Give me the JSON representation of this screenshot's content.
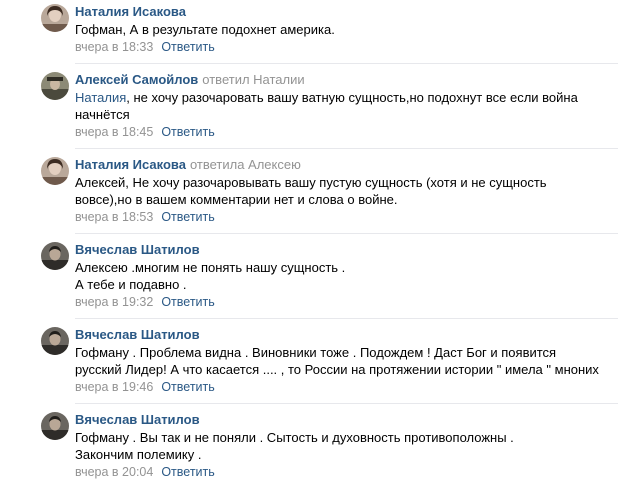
{
  "comments": [
    {
      "author": "Наталия Исакова",
      "reply_to": "",
      "mention": "",
      "lines": [
        "Гофман, А в результате подохнет америка."
      ],
      "date": "вчера в 18:33",
      "reply_label": "Ответить"
    },
    {
      "author": "Алексей Самойлов",
      "reply_to": "ответил Наталии",
      "mention": "Наталия",
      "lines": [
        ", не хочу разочаровать вашу ватную сущность,но подохнут все если война",
        "начнётся"
      ],
      "date": "вчера в 18:45",
      "reply_label": "Ответить"
    },
    {
      "author": "Наталия Исакова",
      "reply_to": "ответила Алексею",
      "mention": "",
      "lines": [
        "Алексей, Не хочу разочаровывать вашу пустую сущность (хотя и не сущность",
        "вовсе),но в вашем комментарии нет и слова о войне."
      ],
      "date": "вчера в 18:53",
      "reply_label": "Ответить"
    },
    {
      "author": "Вячеслав Шатилов",
      "reply_to": "",
      "mention": "",
      "lines": [
        "Алексею .многим не понять нашу сущность .",
        "А тебе и подавно ."
      ],
      "date": "вчера в 19:32",
      "reply_label": "Ответить"
    },
    {
      "author": "Вячеслав Шатилов",
      "reply_to": "",
      "mention": "",
      "lines": [
        "Гофману . Проблема видна . Виновники тоже . Подождем ! Даст Бог и появится",
        "русский Лидер! А что касается .... , то России на протяжении истории \" имела \" мнoних"
      ],
      "date": "вчера в 19:46",
      "reply_label": "Ответить"
    },
    {
      "author": "Вячеслав Шатилов",
      "reply_to": "",
      "mention": "",
      "lines": [
        "Гофману . Вы так и не поняли . Сытость и духовность противоположны .",
        "Закончим полемику ."
      ],
      "date": "вчера в 20:04",
      "reply_label": "Ответить"
    }
  ]
}
